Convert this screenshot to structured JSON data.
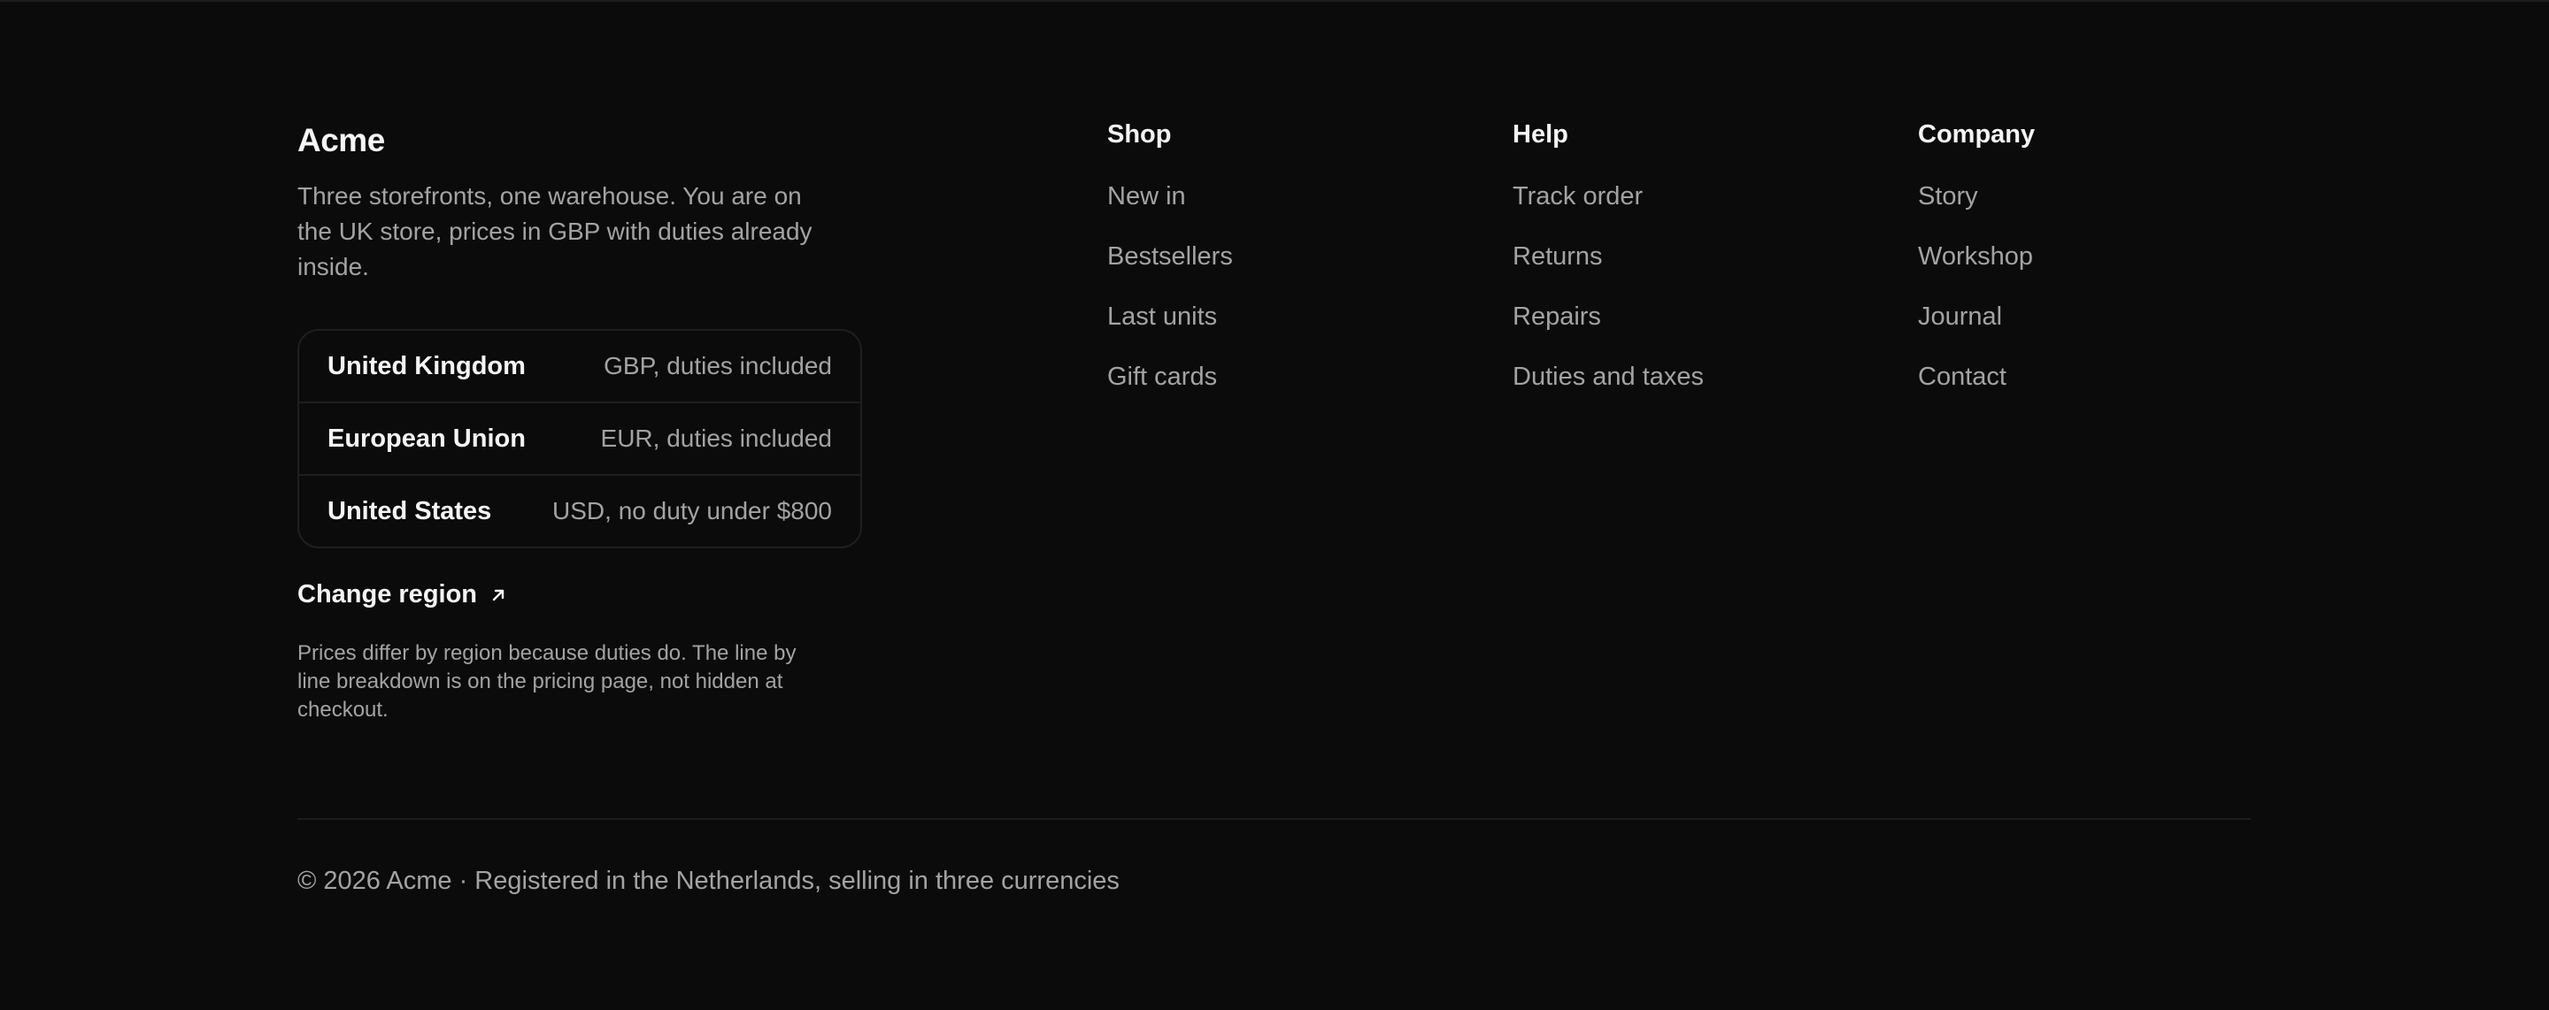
{
  "brand": {
    "name": "Acme",
    "description": "Three storefronts, one warehouse. You are on the UK store, prices in GBP with duties already inside."
  },
  "regions": [
    {
      "name": "United Kingdom",
      "detail": "GBP, duties included"
    },
    {
      "name": "European Union",
      "detail": "EUR, duties included"
    },
    {
      "name": "United States",
      "detail": "USD, no duty under $800"
    }
  ],
  "change_region": {
    "label": "Change region",
    "icon": "arrow-up-right-icon"
  },
  "pricing_note": "Prices differ by region because duties do. The line by line breakdown is on the pricing page, not hidden at checkout.",
  "nav": {
    "shop": {
      "title": "Shop",
      "items": [
        "New in",
        "Bestsellers",
        "Last units",
        "Gift cards"
      ]
    },
    "help": {
      "title": "Help",
      "items": [
        "Track order",
        "Returns",
        "Repairs",
        "Duties and taxes"
      ]
    },
    "company": {
      "title": "Company",
      "items": [
        "Story",
        "Workshop",
        "Journal",
        "Contact"
      ]
    }
  },
  "copyright": "© 2026 Acme · Registered in the Netherlands, selling in three currencies",
  "colors": {
    "background": "#0b0b0b",
    "text_primary": "#f5f5f5",
    "text_secondary": "#a3a3a3",
    "border": "#1f1f1f"
  }
}
